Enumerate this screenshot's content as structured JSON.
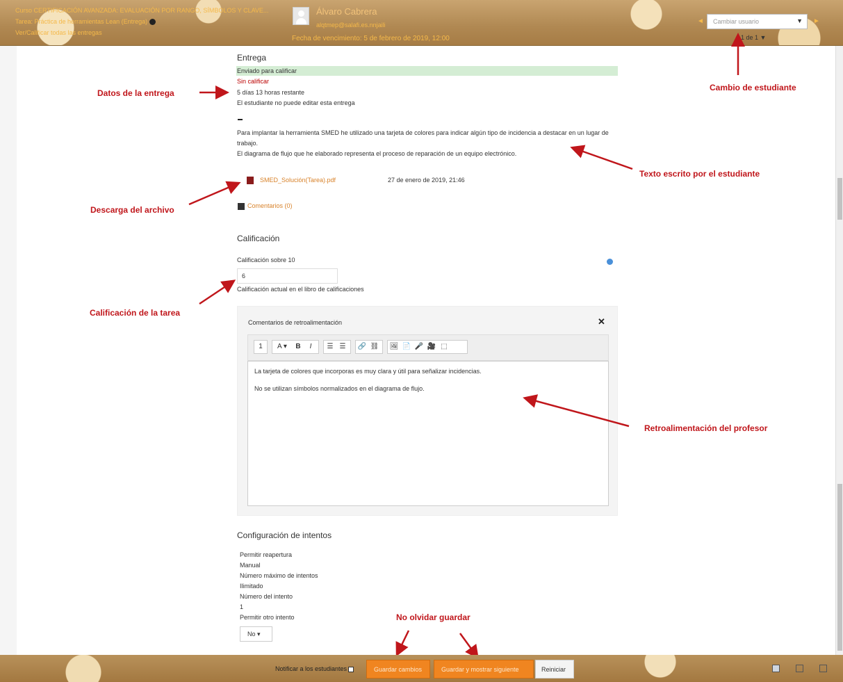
{
  "header": {
    "course": "Curso CERTIFICACIÓN AVANZADA: EVALUACIÓN POR RANGO, SÍMBOLOS Y CLAVE...",
    "assignment": "Tarea: Práctica de herramientas Lean (Entrega)",
    "view_all": "Ver/Calificar todas las entregas",
    "student_name": "Álvaro Cabrera",
    "student_email": "alqtmep@salafi.es.nnjaili",
    "due": "Fecha de vencimiento: 5 de febrero de 2019, 12:00",
    "change_user_placeholder": "Cambiar usuario",
    "prev_arrow": "◄",
    "next_arrow": "►",
    "pager": "1 de 1 ▼"
  },
  "submission": {
    "title": "Entrega",
    "status": "Enviado para calificar",
    "grading_status": "Sin calificar",
    "time_remaining": "5 días 13 horas restante",
    "editing": "El estudiante no puede editar esta entrega",
    "text_line1": "Para implantar la herramienta SMED he utilizado una tarjeta de colores para indicar algún tipo de incidencia a destacar en un lugar de trabajo.",
    "text_line2": "El diagrama de flujo que he elaborado representa el proceso de reparación de un equipo electrónico.",
    "file_name": "SMED_Solución(Tarea).pdf",
    "file_date": "27 de enero de 2019, 21:46",
    "comments": "Comentarios (0)"
  },
  "grade": {
    "title": "Calificación",
    "label": "Calificación sobre 10",
    "value": "6",
    "current_note": "Calificación actual en el libro de calificaciones"
  },
  "feedback": {
    "title": "Comentarios de retroalimentación",
    "close": "✕",
    "line1": "La tarjeta de colores que incorporas es muy clara y útil para señalizar incidencias.",
    "line2": "No se utilizan símbolos normalizados en el diagrama de flujo.",
    "toolbar": [
      "1",
      "A ▾",
      "B",
      "I",
      "☰",
      "☰",
      "🔗",
      "⛓",
      "🖼",
      "📄",
      "🎤",
      "🎥",
      "⬚"
    ]
  },
  "attempts": {
    "title": "Configuración de intentos",
    "items": [
      "Permitir reapertura",
      "Manual",
      "Número máximo de intentos",
      "Ilimitado",
      "Número del intento",
      "1",
      "Permitir otro intento"
    ],
    "select_value": "No ▾"
  },
  "annotations": {
    "entrega": "Datos de la entrega",
    "cambio": "Cambio de estudiante",
    "texto": "Texto escrito por el estudiante",
    "descarga": "Descarga del archivo",
    "calificacion": "Calificación de la tarea",
    "retro": "Retroalimentación del profesor",
    "guardar": "No olvidar guardar",
    "color": "#c0161b"
  },
  "footer": {
    "notify": "Notificar a los estudiantes",
    "save": "Guardar cambios",
    "save_next": "Guardar y mostrar siguiente",
    "reset": "Reiniciar"
  }
}
